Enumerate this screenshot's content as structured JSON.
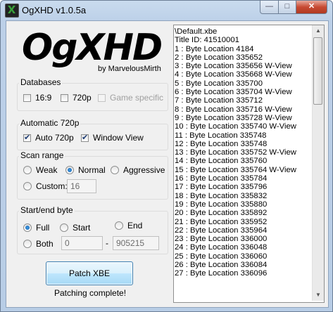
{
  "window": {
    "title": "OgXHD v1.0.5a",
    "minimize": "—",
    "maximize": "□",
    "close": "✕"
  },
  "logo": {
    "text": "OgXHD",
    "byline": "by MarvelousMirth"
  },
  "databases": {
    "label": "Databases",
    "opt_169": "16:9",
    "opt_720p": "720p",
    "opt_game": "Game specific"
  },
  "auto720": {
    "label": "Automatic 720p",
    "auto": "Auto 720p",
    "window_view": "Window View"
  },
  "scan": {
    "label": "Scan range",
    "weak": "Weak",
    "normal": "Normal",
    "aggressive": "Aggressive",
    "custom": "Custom:",
    "custom_value": "16"
  },
  "startend": {
    "label": "Start/end byte",
    "full": "Full",
    "start": "Start",
    "end": "End",
    "both": "Both",
    "start_value": "0",
    "dash": "-",
    "end_value": "905215"
  },
  "patch": {
    "button": "Patch XBE",
    "status": "Patching complete!"
  },
  "log": [
    "\\Default.xbe",
    "Title ID: 41510001",
    "1 : Byte Location 4184",
    "2 : Byte Location 335652",
    "3 : Byte Location 335656 W-View",
    "4 : Byte Location 335668 W-View",
    "5 : Byte Location 335700",
    "6 : Byte Location 335704 W-View",
    "7 : Byte Location 335712",
    "8 : Byte Location 335716 W-View",
    "9 : Byte Location 335728 W-View",
    "10 : Byte Location 335740 W-View",
    "11 : Byte Location 335748",
    "12 : Byte Location 335748",
    "13 : Byte Location 335752 W-View",
    "14 : Byte Location 335760",
    "15 : Byte Location 335764 W-View",
    "16 : Byte Location 335784",
    "17 : Byte Location 335796",
    "18 : Byte Location 335832",
    "19 : Byte Location 335880",
    "20 : Byte Location 335892",
    "21 : Byte Location 335952",
    "22 : Byte Location 335964",
    "23 : Byte Location 336000",
    "24 : Byte Location 336048",
    "25 : Byte Location 336060",
    "26 : Byte Location 336084",
    "27 : Byte Location 336096"
  ]
}
